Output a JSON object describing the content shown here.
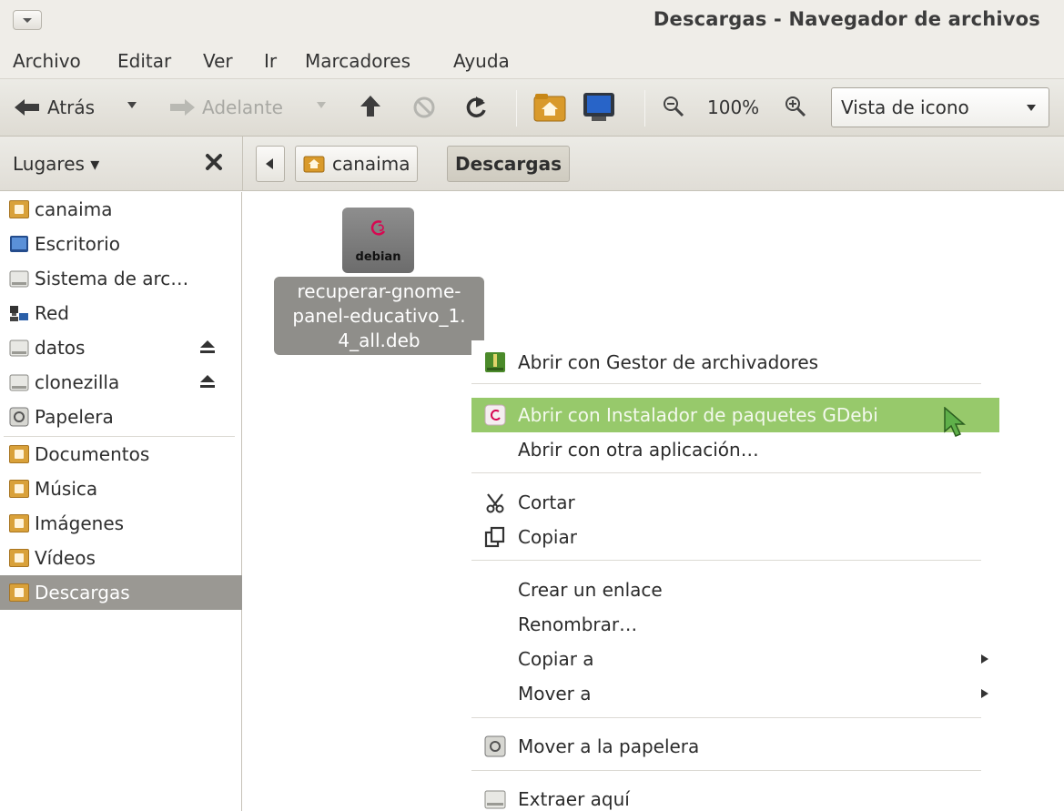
{
  "window": {
    "title": "Descargas - Navegador de archivos"
  },
  "menubar": [
    "Archivo",
    "Editar",
    "Ver",
    "Ir",
    "Marcadores",
    "Ayuda"
  ],
  "toolbar": {
    "back_label": "Atrás",
    "forward_label": "Adelante",
    "zoom_level": "100%",
    "view_mode": "Vista de icono"
  },
  "places": {
    "header": "Lugares ▾",
    "items": [
      {
        "label": "canaima",
        "icon": "home-folder-icon"
      },
      {
        "label": "Escritorio",
        "icon": "desktop-icon"
      },
      {
        "label": "Sistema de arc…",
        "icon": "drive-icon"
      },
      {
        "label": "Red",
        "icon": "network-icon"
      },
      {
        "label": "datos",
        "icon": "drive-icon",
        "eject": true
      },
      {
        "label": "clonezilla",
        "icon": "drive-icon",
        "eject": true
      },
      {
        "label": "Papelera",
        "icon": "trash-icon"
      },
      {
        "label": "Documentos",
        "icon": "folder-documents-icon"
      },
      {
        "label": "Música",
        "icon": "folder-music-icon"
      },
      {
        "label": "Imágenes",
        "icon": "folder-pictures-icon"
      },
      {
        "label": "Vídeos",
        "icon": "folder-videos-icon"
      },
      {
        "label": "Descargas",
        "icon": "folder-downloads-icon",
        "selected": true
      }
    ]
  },
  "pathbar": {
    "crumbs": [
      "canaima",
      "Descargas"
    ],
    "active": "Descargas"
  },
  "file": {
    "icon_text": "debian",
    "name_lines": [
      "recuperar-gnome-",
      "panel-educativo_1.",
      "4_all.deb"
    ]
  },
  "context_menu": {
    "items": [
      {
        "label": "Abrir con Gestor de archivadores",
        "mnemonic": "A"
      },
      {
        "label": "Abrir con Instalador de paquetes GDebi",
        "highlight": true
      },
      {
        "label": "Abrir con otra aplicación…"
      },
      {
        "label": "Cortar"
      },
      {
        "label": "Copiar"
      },
      {
        "label": "Crear un enlace"
      },
      {
        "label": "Renombrar…"
      },
      {
        "label": "Copiar a"
      },
      {
        "label": "Mover a"
      },
      {
        "label": "Mover a la papelera"
      },
      {
        "label": "Extraer aquí"
      }
    ]
  },
  "colors": {
    "highlight": "#97c96b",
    "selection": "#9a9893",
    "folder": "#d9a13a"
  }
}
